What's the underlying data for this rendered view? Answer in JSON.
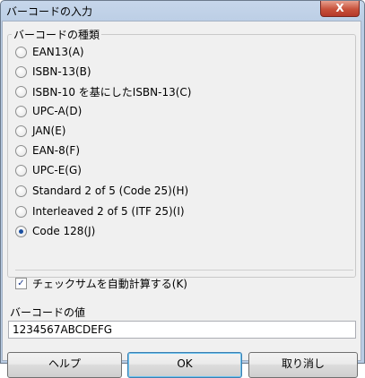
{
  "window": {
    "title": "バーコードの入力",
    "close_label": "X"
  },
  "group": {
    "legend": "バーコードの種類",
    "options": [
      {
        "label": "EAN13(A)",
        "selected": false
      },
      {
        "label": "ISBN-13(B)",
        "selected": false
      },
      {
        "label": "ISBN-10 を基にしたISBN-13(C)",
        "selected": false
      },
      {
        "label": "UPC-A(D)",
        "selected": false
      },
      {
        "label": "JAN(E)",
        "selected": false
      },
      {
        "label": "EAN-8(F)",
        "selected": false
      },
      {
        "label": "UPC-E(G)",
        "selected": false
      },
      {
        "label": "Standard 2 of 5 (Code 25)(H)",
        "selected": false
      },
      {
        "label": "Interleaved 2 of 5 (ITF 25)(I)",
        "selected": false
      },
      {
        "label": "Code 128(J)",
        "selected": true
      }
    ]
  },
  "checksum": {
    "label": "チェックサムを自動計算する(K)",
    "checked": true
  },
  "value": {
    "label": "バーコードの値",
    "input_value": "1234567ABCDEFG"
  },
  "buttons": {
    "help": "ヘルプ",
    "ok": "OK",
    "cancel": "取り消し"
  }
}
